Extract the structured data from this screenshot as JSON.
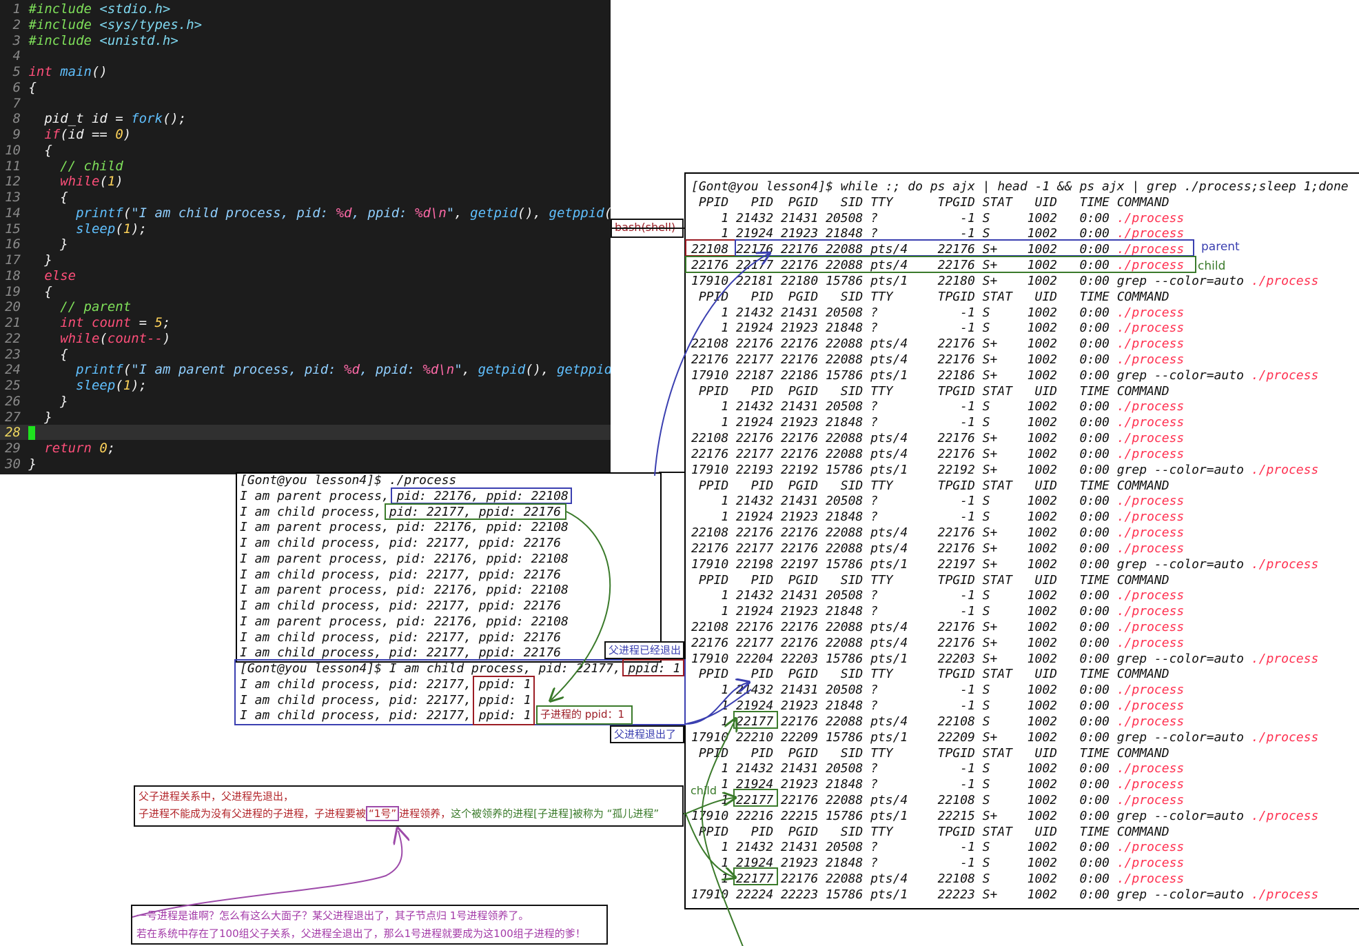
{
  "editor": {
    "lines": [
      {
        "n": "1",
        "tokens": [
          [
            "pre",
            "#include "
          ],
          [
            "hdr",
            "<stdio.h>"
          ]
        ]
      },
      {
        "n": "2",
        "tokens": [
          [
            "pre",
            "#include "
          ],
          [
            "hdr",
            "<sys/types.h>"
          ]
        ]
      },
      {
        "n": "3",
        "tokens": [
          [
            "pre",
            "#include "
          ],
          [
            "hdr",
            "<unistd.h>"
          ]
        ]
      },
      {
        "n": "4",
        "tokens": []
      },
      {
        "n": "5",
        "tokens": [
          [
            "kw",
            "int "
          ],
          [
            "fn",
            "main"
          ],
          [
            "pl",
            "()"
          ]
        ]
      },
      {
        "n": "6",
        "tokens": [
          [
            "pl",
            "{"
          ]
        ]
      },
      {
        "n": "7",
        "tokens": []
      },
      {
        "n": "8",
        "tokens": [
          [
            "pl",
            "  pid_t id = "
          ],
          [
            "fn",
            "fork"
          ],
          [
            "pl",
            "();"
          ]
        ]
      },
      {
        "n": "9",
        "tokens": [
          [
            "pl",
            "  "
          ],
          [
            "kw",
            "if"
          ],
          [
            "pl",
            "(id == "
          ],
          [
            "num",
            "0"
          ],
          [
            "pl",
            ")"
          ]
        ]
      },
      {
        "n": "10",
        "tokens": [
          [
            "pl",
            "  {"
          ]
        ]
      },
      {
        "n": "11",
        "tokens": [
          [
            "cm",
            "    // child"
          ]
        ]
      },
      {
        "n": "12",
        "tokens": [
          [
            "pl",
            "    "
          ],
          [
            "kw",
            "while"
          ],
          [
            "pl",
            "("
          ],
          [
            "num",
            "1"
          ],
          [
            "pl",
            ")"
          ]
        ]
      },
      {
        "n": "13",
        "tokens": [
          [
            "pl",
            "    {"
          ]
        ]
      },
      {
        "n": "14",
        "tokens": [
          [
            "pl",
            "      "
          ],
          [
            "fn",
            "printf"
          ],
          [
            "pl",
            "("
          ],
          [
            "str",
            "\"I am child process, pid: "
          ],
          [
            "fmt",
            "%d"
          ],
          [
            "str",
            ", ppid: "
          ],
          [
            "fmt",
            "%d\\n"
          ],
          [
            "str",
            "\""
          ],
          [
            "pl",
            ", "
          ],
          [
            "fn",
            "getpid"
          ],
          [
            "pl",
            "(), "
          ],
          [
            "fn",
            "getppid"
          ],
          [
            "pl",
            "());"
          ]
        ]
      },
      {
        "n": "15",
        "tokens": [
          [
            "pl",
            "      "
          ],
          [
            "fn",
            "sleep"
          ],
          [
            "pl",
            "("
          ],
          [
            "num",
            "1"
          ],
          [
            "pl",
            ");"
          ]
        ]
      },
      {
        "n": "16",
        "tokens": [
          [
            "pl",
            "    }"
          ]
        ]
      },
      {
        "n": "17",
        "tokens": [
          [
            "pl",
            "  }"
          ]
        ]
      },
      {
        "n": "18",
        "tokens": [
          [
            "pl",
            "  "
          ],
          [
            "kw",
            "else"
          ]
        ]
      },
      {
        "n": "19",
        "tokens": [
          [
            "pl",
            "  {"
          ]
        ]
      },
      {
        "n": "20",
        "tokens": [
          [
            "cm",
            "    // parent"
          ]
        ]
      },
      {
        "n": "21",
        "tokens": [
          [
            "pl",
            "    "
          ],
          [
            "kw",
            "int"
          ],
          [
            "pl",
            " "
          ],
          [
            "kw",
            "count"
          ],
          [
            "pl",
            " = "
          ],
          [
            "num",
            "5"
          ],
          [
            "pl",
            ";"
          ]
        ]
      },
      {
        "n": "22",
        "tokens": [
          [
            "pl",
            "    "
          ],
          [
            "kw",
            "while"
          ],
          [
            "pl",
            "("
          ],
          [
            "kw",
            "count--"
          ],
          [
            "pl",
            ")"
          ]
        ]
      },
      {
        "n": "23",
        "tokens": [
          [
            "pl",
            "    {"
          ]
        ]
      },
      {
        "n": "24",
        "tokens": [
          [
            "pl",
            "      "
          ],
          [
            "fn",
            "printf"
          ],
          [
            "pl",
            "("
          ],
          [
            "str",
            "\"I am parent process, pid: "
          ],
          [
            "fmt",
            "%d"
          ],
          [
            "str",
            ", ppid: "
          ],
          [
            "fmt",
            "%d\\n"
          ],
          [
            "str",
            "\""
          ],
          [
            "pl",
            ", "
          ],
          [
            "fn",
            "getpid"
          ],
          [
            "pl",
            "(), "
          ],
          [
            "fn",
            "getppid"
          ],
          [
            "pl",
            "());"
          ]
        ]
      },
      {
        "n": "25",
        "tokens": [
          [
            "pl",
            "      "
          ],
          [
            "fn",
            "sleep"
          ],
          [
            "pl",
            "("
          ],
          [
            "num",
            "1"
          ],
          [
            "pl",
            ");"
          ]
        ]
      },
      {
        "n": "26",
        "tokens": [
          [
            "pl",
            "    }"
          ]
        ]
      },
      {
        "n": "27",
        "tokens": [
          [
            "pl",
            "  }"
          ]
        ]
      },
      {
        "n": "28",
        "tokens": [],
        "cursor": true
      },
      {
        "n": "29",
        "tokens": [
          [
            "pl",
            "  "
          ],
          [
            "kw",
            "return "
          ],
          [
            "num",
            "0"
          ],
          [
            "pl",
            ";"
          ]
        ]
      },
      {
        "n": "30",
        "tokens": [
          [
            "pl",
            "}"
          ]
        ]
      }
    ]
  },
  "run_terminal": {
    "lines": [
      "[Gont@you lesson4]$ ./process",
      "I am parent process, pid: 22176, ppid: 22108",
      "I am child process, pid: 22177, ppid: 22176",
      "I am parent process, pid: 22176, ppid: 22108",
      "I am child process, pid: 22177, ppid: 22176",
      "I am parent process, pid: 22176, ppid: 22108",
      "I am child process, pid: 22177, ppid: 22176",
      "I am parent process, pid: 22176, ppid: 22108",
      "I am child process, pid: 22177, ppid: 22176",
      "I am parent process, pid: 22176, ppid: 22108",
      "I am child process, pid: 22177, ppid: 22176",
      "I am child process, pid: 22177, ppid: 22176",
      "[Gont@you lesson4]$ I am child process, pid: 22177, ppid: 1",
      "I am child process, pid: 22177, ppid: 1",
      "I am child process, pid: 22177, ppid: 1",
      "I am child process, pid: 22177, ppid: 1"
    ]
  },
  "ps_terminal": {
    "lines": [
      {
        "t": "[Gont@you lesson4]$ while :; do ps ajx | head -1 && ps ajx | grep ./process;sleep 1;done"
      },
      {
        "t": " PPID   PID  PGID   SID TTY      TPGID STAT   UID   TIME COMMAND"
      },
      {
        "t": "    1 21432 21431 20508 ?           -1 S     1002   0:00 ",
        "r": "./process"
      },
      {
        "t": "    1 21924 21923 21848 ?           -1 S     1002   0:00 ",
        "r": "./process"
      },
      {
        "t": "22108 22176 22176 22088 pts/4    22176 S+    1002   0:00 ",
        "r": "./process"
      },
      {
        "t": "22176 22177 22176 22088 pts/4    22176 S+    1002   0:00 ",
        "r": "./process"
      },
      {
        "t": "17910 22181 22180 15786 pts/1    22180 S+    1002   0:00 grep --color=auto ",
        "r": "./process"
      },
      {
        "t": " PPID   PID  PGID   SID TTY      TPGID STAT   UID   TIME COMMAND"
      },
      {
        "t": "    1 21432 21431 20508 ?           -1 S     1002   0:00 ",
        "r": "./process"
      },
      {
        "t": "    1 21924 21923 21848 ?           -1 S     1002   0:00 ",
        "r": "./process"
      },
      {
        "t": "22108 22176 22176 22088 pts/4    22176 S+    1002   0:00 ",
        "r": "./process"
      },
      {
        "t": "22176 22177 22176 22088 pts/4    22176 S+    1002   0:00 ",
        "r": "./process"
      },
      {
        "t": "17910 22187 22186 15786 pts/1    22186 S+    1002   0:00 grep --color=auto ",
        "r": "./process"
      },
      {
        "t": " PPID   PID  PGID   SID TTY      TPGID STAT   UID   TIME COMMAND"
      },
      {
        "t": "    1 21432 21431 20508 ?           -1 S     1002   0:00 ",
        "r": "./process"
      },
      {
        "t": "    1 21924 21923 21848 ?           -1 S     1002   0:00 ",
        "r": "./process"
      },
      {
        "t": "22108 22176 22176 22088 pts/4    22176 S+    1002   0:00 ",
        "r": "./process"
      },
      {
        "t": "22176 22177 22176 22088 pts/4    22176 S+    1002   0:00 ",
        "r": "./process"
      },
      {
        "t": "17910 22193 22192 15786 pts/1    22192 S+    1002   0:00 grep --color=auto ",
        "r": "./process"
      },
      {
        "t": " PPID   PID  PGID   SID TTY      TPGID STAT   UID   TIME COMMAND"
      },
      {
        "t": "    1 21432 21431 20508 ?           -1 S     1002   0:00 ",
        "r": "./process"
      },
      {
        "t": "    1 21924 21923 21848 ?           -1 S     1002   0:00 ",
        "r": "./process"
      },
      {
        "t": "22108 22176 22176 22088 pts/4    22176 S+    1002   0:00 ",
        "r": "./process"
      },
      {
        "t": "22176 22177 22176 22088 pts/4    22176 S+    1002   0:00 ",
        "r": "./process"
      },
      {
        "t": "17910 22198 22197 15786 pts/1    22197 S+    1002   0:00 grep --color=auto ",
        "r": "./process"
      },
      {
        "t": " PPID   PID  PGID   SID TTY      TPGID STAT   UID   TIME COMMAND"
      },
      {
        "t": "    1 21432 21431 20508 ?           -1 S     1002   0:00 ",
        "r": "./process"
      },
      {
        "t": "    1 21924 21923 21848 ?           -1 S     1002   0:00 ",
        "r": "./process"
      },
      {
        "t": "22108 22176 22176 22088 pts/4    22176 S+    1002   0:00 ",
        "r": "./process"
      },
      {
        "t": "22176 22177 22176 22088 pts/4    22176 S+    1002   0:00 ",
        "r": "./process"
      },
      {
        "t": "17910 22204 22203 15786 pts/1    22203 S+    1002   0:00 grep --color=auto ",
        "r": "./process"
      },
      {
        "t": " PPID   PID  PGID   SID TTY      TPGID STAT   UID   TIME COMMAND"
      },
      {
        "t": "    1 21432 21431 20508 ?           -1 S     1002   0:00 ",
        "r": "./process"
      },
      {
        "t": "    1 21924 21923 21848 ?           -1 S     1002   0:00 ",
        "r": "./process"
      },
      {
        "t": "    1 22177 22176 22088 pts/4    22108 S     1002   0:00 ",
        "r": "./process"
      },
      {
        "t": "17910 22210 22209 15786 pts/1    22209 S+    1002   0:00 grep --color=auto ",
        "r": "./process"
      },
      {
        "t": " PPID   PID  PGID   SID TTY      TPGID STAT   UID   TIME COMMAND"
      },
      {
        "t": "    1 21432 21431 20508 ?           -1 S     1002   0:00 ",
        "r": "./process"
      },
      {
        "t": "    1 21924 21923 21848 ?           -1 S     1002   0:00 ",
        "r": "./process"
      },
      {
        "t": "    1 22177 22176 22088 pts/4    22108 S     1002   0:00 ",
        "r": "./process"
      },
      {
        "t": "17910 22216 22215 15786 pts/1    22215 S+    1002   0:00 grep --color=auto ",
        "r": "./process"
      },
      {
        "t": " PPID   PID  PGID   SID TTY      TPGID STAT   UID   TIME COMMAND"
      },
      {
        "t": "    1 21432 21431 20508 ?           -1 S     1002   0:00 ",
        "r": "./process"
      },
      {
        "t": "    1 21924 21923 21848 ?           -1 S     1002   0:00 ",
        "r": "./process"
      },
      {
        "t": "    1 22177 22176 22088 pts/4    22108 S     1002   0:00 ",
        "r": "./process"
      },
      {
        "t": "17910 22224 22223 15786 pts/1    22223 S+    1002   0:00 grep --color=auto ",
        "r": "./process"
      }
    ]
  },
  "annotations": {
    "bash_shell": "bash(shell)",
    "parent": "parent",
    "child": "child",
    "child_tag": "child",
    "parent_exited": "父进程已经退出",
    "child_ppid": "子进程的 ppid：1",
    "parent_exited2": "父进程退出了",
    "note1_line1": "父子进程关系中，父进程先退出，",
    "note1_line2a": "子进程不能成为没有父进程的子进程，子进程要被",
    "note1_line2b": "“1号”",
    "note1_line2c": "进程领养，",
    "note1_line2d": "这个被领养的进程[子进程]被称为 “孤儿进程”",
    "note2_line1": "一号进程是谁啊？怎么有这么大面子？某父进程退出了，其子节点归 1号进程领养了。",
    "note2_line2": "若在系统中存在了100组父子关系，父进程全退出了，那么1号进程就要成为这100组子进程的爹！"
  },
  "colors": {
    "annot_red": "#9b1c24",
    "annot_blue": "#3a3fb0",
    "annot_green": "#3a7a2a",
    "annot_purple": "#9d4aa9",
    "process_red": "#ff3050"
  }
}
